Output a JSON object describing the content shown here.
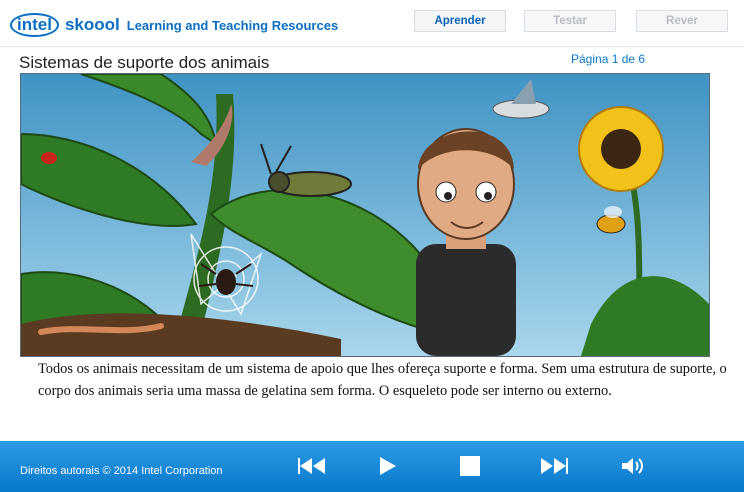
{
  "header": {
    "logo_intel": "intel",
    "logo_skoool": "skoool",
    "logo_tagline": "Learning and Teaching Resources",
    "tabs": [
      {
        "label": "Aprender",
        "active": true
      },
      {
        "label": "Testar",
        "active": false
      },
      {
        "label": "Rever",
        "active": false
      }
    ]
  },
  "lesson": {
    "title": "Sistemas de suporte dos animais",
    "page_indicator": "Página 1 de 6",
    "body": "Todos os animais necessitam de um sistema de apoio que lhes ofereça suporte e forma. Sem uma estrutura de suporte, o corpo dos animais seria uma massa de gelatina sem forma.  O esqueleto pode ser interno ou externo."
  },
  "footer": {
    "copyright": "Direitos autorais © 2014 Intel Corporation",
    "controls": [
      "rewind-icon",
      "play-icon",
      "stop-icon",
      "fast-forward-icon",
      "volume-icon"
    ]
  },
  "colors": {
    "brand": "#0a6fc2",
    "footer": "#0878c9",
    "sky": "#5aa6cf"
  }
}
